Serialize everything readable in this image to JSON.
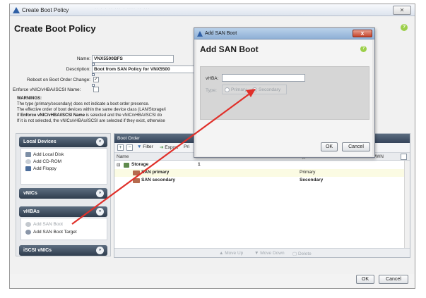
{
  "window": {
    "title": "Create Boot Policy",
    "faint_title": "·· · · ·· ··· · ···· ·· ···",
    "close_label": "✕"
  },
  "page": {
    "title": "Create Boot Policy",
    "help": "?"
  },
  "form": {
    "name_label": "Name:",
    "name_value": "VNX5500BFS",
    "description_label": "Description:",
    "description_value": "Boot from SAN Policy for VNX5500",
    "reboot_label": "Reboot on Boot Order Change:",
    "reboot_checked": "✓",
    "enforce_label": "Enforce vNIC/vHBA/iSCSI Name:"
  },
  "warnings": {
    "title": "WARNINGS:",
    "line1": "The type (primary/secondary) does not indicate a boot order presence.",
    "line2": "The effective order of boot devices within the same device class (LAN/Storage/i",
    "line3_prefix": "If ",
    "line3_bold": "Enforce vNIC/vHBA/iSCSI Name",
    "line3_suffix": " is selected and the vNIC/vHBA/iSCSI do",
    "line4": "If it is not selected, the vNICs/vHBAs/iSCSI are selected if they exist, otherwise"
  },
  "accordion": {
    "local_devices": "Local Devices",
    "add_local_disk": "Add Local Disk",
    "add_cd_rom": "Add CD-ROM",
    "add_floppy": "Add Floppy",
    "vnics": "vNICs",
    "vhbas": "vHBAs",
    "add_san_boot": "Add SAN Boot",
    "add_san_boot_target": "Add SAN Boot Target",
    "iscsi_vnics": "iSCSI vNICs",
    "collapse": "«",
    "expand": "»"
  },
  "boot_order": {
    "header": "Boot Order",
    "toolbar": {
      "add": "+",
      "remove": "−",
      "filter": "Filter",
      "export": "Export",
      "print": "Pri"
    },
    "columns": [
      "Name",
      "Order",
      "vNIC/vHBA/iSCSI vNIC",
      "Type",
      "Lun ID",
      "WWN"
    ],
    "rows": [
      {
        "name": "Storage",
        "order": "1",
        "type": ""
      },
      {
        "name": "SAN primary",
        "order": "",
        "type": "Primary"
      },
      {
        "name": "SAN secondary",
        "order": "",
        "type": "Secondary"
      }
    ],
    "footer": {
      "move_up": "Move Up",
      "move_down": "Move Down",
      "delete": "Delete"
    }
  },
  "main_buttons": {
    "ok": "OK",
    "cancel": "Cancel"
  },
  "dialog": {
    "window_title": "Add SAN Boot",
    "heading": "Add SAN Boot",
    "help": "?",
    "close": "X",
    "vhba_label": "vHBA:",
    "vhba_value": "",
    "type_label": "Type:",
    "primary_label": "Primary",
    "secondary_label": "Secondary",
    "selected_type": "Secondary",
    "ok": "OK",
    "cancel": "Cancel"
  },
  "colors": {
    "arrow": "#e0302a",
    "header_dark": "#34435a",
    "help_green": "#9ccf4a"
  }
}
